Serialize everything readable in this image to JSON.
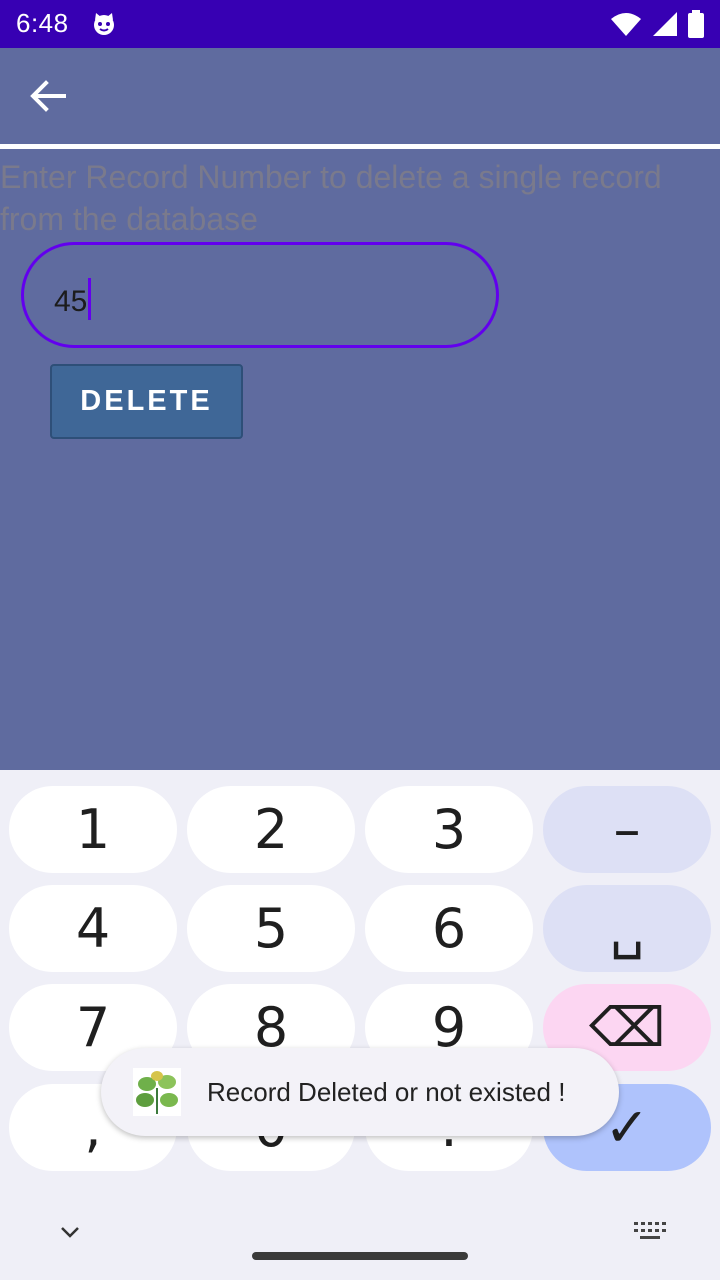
{
  "status_bar": {
    "time": "6:48"
  },
  "prompt": "Enter Record Number to delete a single record from the database",
  "record_input": {
    "value": "45"
  },
  "delete_button": {
    "label": "DELETE"
  },
  "keyboard": {
    "keys": [
      [
        "1",
        "2",
        "3",
        "–"
      ],
      [
        "4",
        "5",
        "6",
        "␣"
      ],
      [
        "7",
        "8",
        "9",
        "⌫"
      ],
      [
        ",",
        "0",
        ".",
        "✓"
      ]
    ]
  },
  "toast": {
    "message": "Record Deleted or not existed !"
  },
  "colors": {
    "status_bar": "#3700b3",
    "app_bg": "#5f6b9f",
    "accent": "#6200ee",
    "button": "#3f6797"
  }
}
